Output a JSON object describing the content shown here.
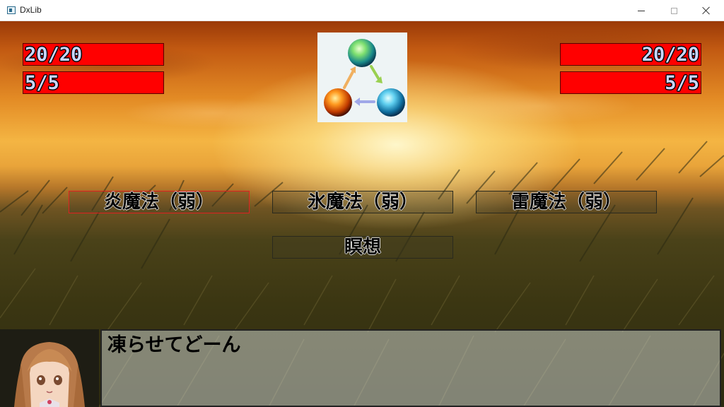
{
  "window": {
    "title": "DxLib"
  },
  "player": {
    "hp": "20/20",
    "mp": "5/5"
  },
  "enemy": {
    "hp": "20/20",
    "mp": "5/5"
  },
  "colors": {
    "bar_fill": "#ff0000",
    "fire": "#e07010",
    "wind": "#30c040",
    "ice": "#30b0e0",
    "select_border": "#e02020"
  },
  "commands": [
    {
      "label": "炎魔法（弱）",
      "selected": true
    },
    {
      "label": "氷魔法（弱）",
      "selected": false
    },
    {
      "label": "雷魔法（弱）",
      "selected": false
    },
    {
      "label": "瞑想",
      "selected": false
    }
  ],
  "message": {
    "text": "凍らせてどーん"
  },
  "element_chart": {
    "orbs": [
      "wind-orb",
      "fire-orb",
      "ice-orb"
    ]
  }
}
